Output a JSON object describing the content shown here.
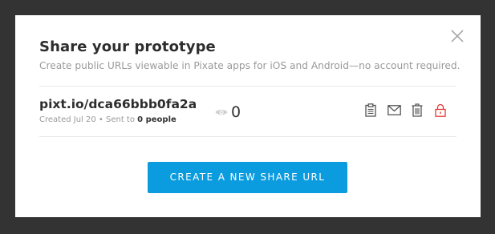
{
  "dialog": {
    "title": "Share your prototype",
    "subtitle": "Create public URLs viewable in Pixate apps for iOS and Android—no account required."
  },
  "share": {
    "url": "pixt.io/dca66bbb0fa2a",
    "created_text": "Created Jul 20 • Sent to",
    "sent_count": "0 people",
    "view_count": "0"
  },
  "cta": {
    "label": "CREATE A NEW SHARE URL"
  },
  "icons": {
    "close": "close-icon",
    "views": "eye-icon",
    "copy": "clipboard-icon",
    "email": "envelope-icon",
    "delete": "trash-icon",
    "lock": "lock-icon"
  },
  "colors": {
    "backdrop": "#333333",
    "dialog_bg": "#ffffff",
    "primary": "#0b9cdf",
    "lock": "#e53935",
    "text_dark": "#2d2d2d",
    "text_muted": "#9a9a9a"
  }
}
